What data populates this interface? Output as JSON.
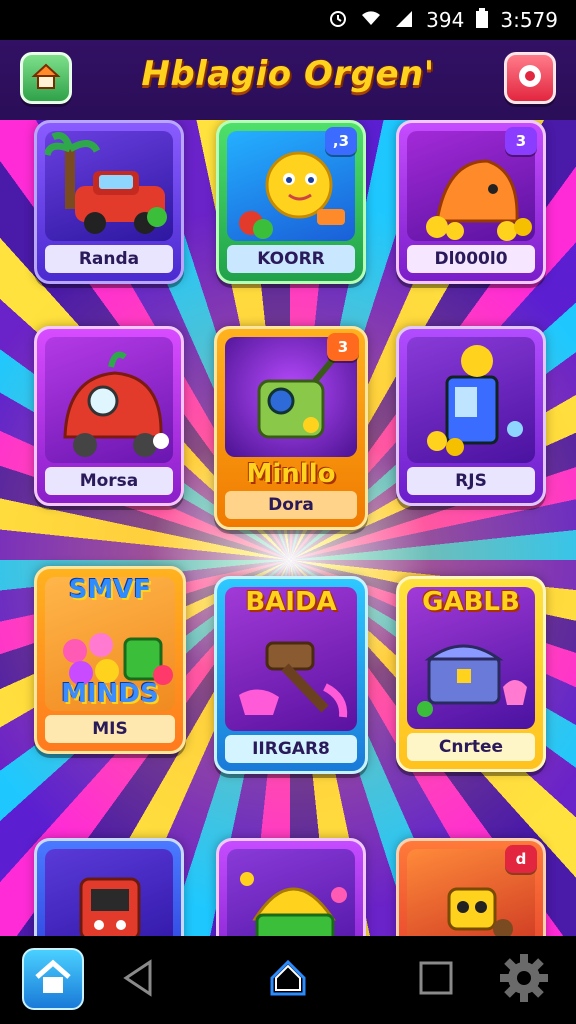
{
  "status_bar": {
    "battery": "394",
    "time": "3:579"
  },
  "header": {
    "title": "Hblagio Orgen'"
  },
  "cards": [
    {
      "label": "Randa"
    },
    {
      "label": "KOORR",
      "badge": ",3"
    },
    {
      "label": "Dl000l0",
      "badge": "3"
    },
    {
      "label": "Morsa"
    },
    {
      "title": "Minllo",
      "label": "Dora",
      "badge": "3"
    },
    {
      "label": "RJS"
    },
    {
      "title_top": "SMVF",
      "title_bottom": "MINDS",
      "label": "MIS"
    },
    {
      "title": "BAIDA",
      "label": "IIRGAR8"
    },
    {
      "title": "GABLB",
      "label": "Cnrtee"
    },
    {
      "label": ""
    },
    {
      "label": ""
    },
    {
      "label": "",
      "badge": "d"
    }
  ],
  "bottom_nav": {
    "items": [
      "home",
      "back",
      "home-circle",
      "recents",
      "settings"
    ]
  },
  "colors": {
    "accent": "#ffd21e",
    "header_bg": "#2a0e58"
  }
}
